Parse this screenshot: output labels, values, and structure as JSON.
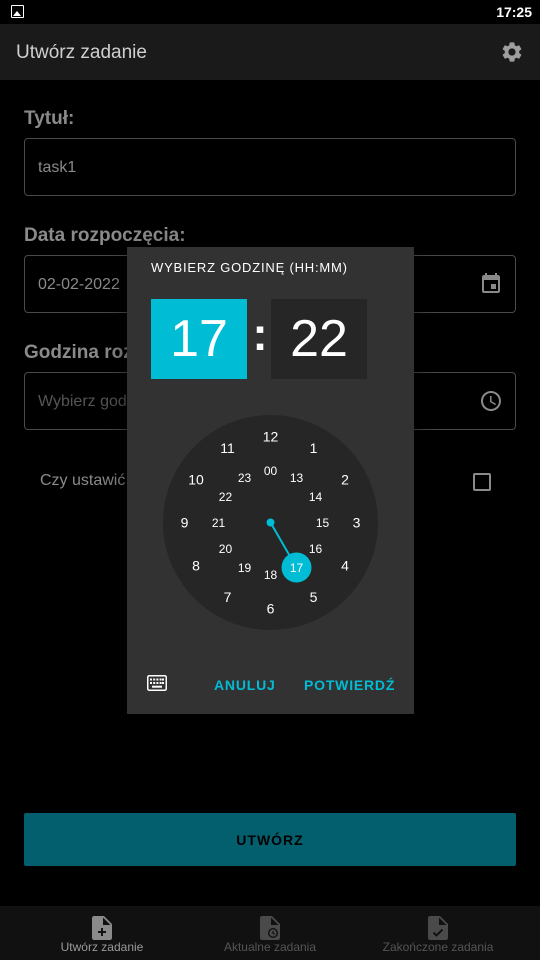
{
  "status_bar": {
    "time": "17:25",
    "notification_icon": "image-icon"
  },
  "app_bar": {
    "title": "Utwórz zadanie",
    "settings_icon": "gear-icon"
  },
  "form": {
    "title_label": "Tytuł:",
    "title_value": "task1",
    "start_date_label": "Data rozpoczęcia:",
    "start_date_value": "02-02-2022",
    "time_label": "Godzina rozpoczęcia:",
    "time_placeholder": "Wybierz godzinę",
    "reminder_label": "Czy ustawić przypomnienie?",
    "reminder_checked": false,
    "create_button": "UTWÓRZ"
  },
  "time_picker": {
    "title": "WYBIERZ GODZINĘ (HH:MM)",
    "hour": "17",
    "separator": ":",
    "minute": "22",
    "outer_hours": [
      "12",
      "1",
      "2",
      "3",
      "4",
      "5",
      "6",
      "7",
      "8",
      "9",
      "10",
      "11"
    ],
    "inner_hours": [
      "00",
      "13",
      "14",
      "15",
      "16",
      "17",
      "18",
      "19",
      "20",
      "21",
      "22",
      "23"
    ],
    "selected_hour": "17",
    "cancel_label": "ANULUJ",
    "confirm_label": "POTWIERDŹ",
    "accent_color": "#00bcd4"
  },
  "bottom_nav": {
    "items": [
      {
        "label": "Utwórz zadanie",
        "icon": "file-add-icon",
        "active": true
      },
      {
        "label": "Aktualne zadania",
        "icon": "file-clock-icon",
        "active": false
      },
      {
        "label": "Zakończone zadania",
        "icon": "file-check-icon",
        "active": false
      }
    ]
  }
}
